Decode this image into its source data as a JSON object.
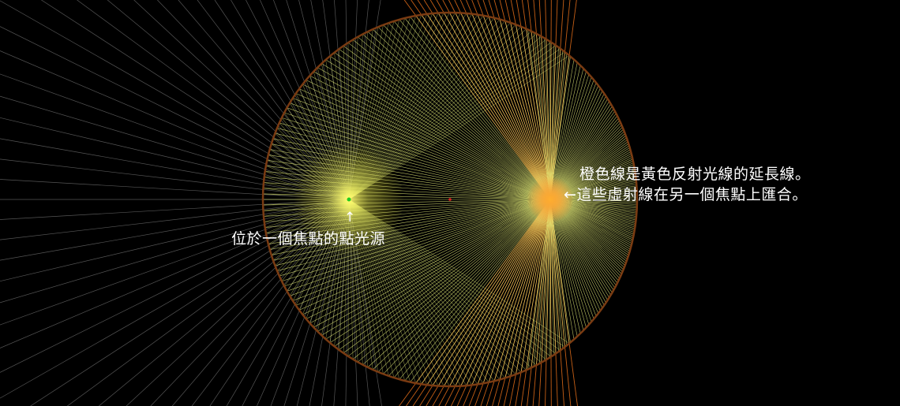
{
  "labels": {
    "light_source": "位於一個焦點的點光源",
    "virtual_line1": "橙色線是黃色反射光線的延長線。",
    "virtual_line2": "←這些虛射線在另一個焦點上匯合。",
    "up_arrow": "↑"
  },
  "colors": {
    "background": "#000000",
    "mirror": "#7a3b12",
    "reflected_rays": "#e8f07a",
    "virtual_rays": "#e8701a",
    "escaping_rays": "#9a9a9a",
    "source_point": "#22cc22",
    "center_point": "#dd2222",
    "glow_inner": "#fffb70",
    "virtual_glow": "#ff8a10"
  }
}
